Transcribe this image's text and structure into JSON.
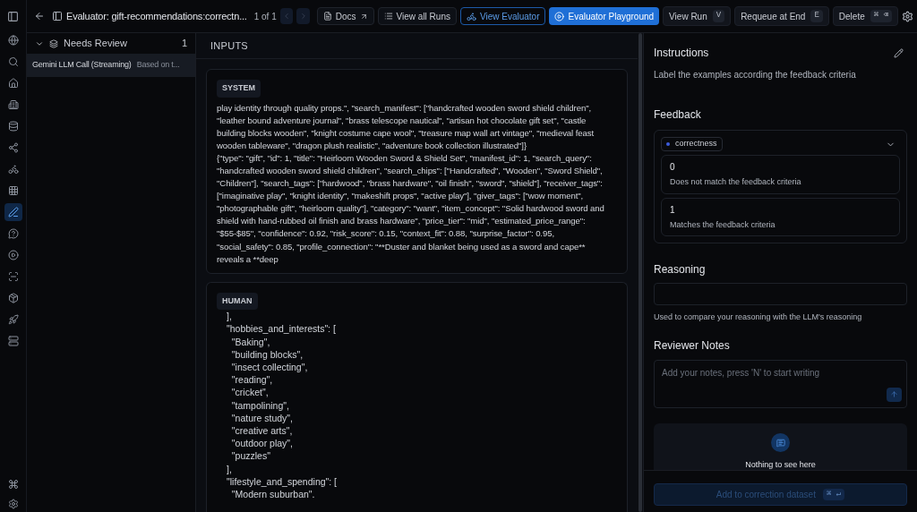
{
  "nav_rail": [
    {
      "selected": false
    },
    {
      "selected": false
    },
    {
      "selected": false
    },
    {
      "selected": false
    },
    {
      "selected": false
    },
    {
      "selected": false
    },
    {
      "selected": false
    },
    {
      "selected": false
    },
    {
      "selected": true
    },
    {
      "selected": false
    },
    {
      "selected": false
    },
    {
      "selected": false
    },
    {
      "selected": false
    },
    {
      "selected": false
    },
    {
      "selected": false
    }
  ],
  "header": {
    "title": "Evaluator: gift-recommendations:correctn...",
    "pager": "1 of 1",
    "buttons": [
      {
        "kind": "outline",
        "label": "Docs"
      },
      {
        "kind": "outline",
        "label": "View all Runs"
      },
      {
        "kind": "accent",
        "label": "View Evaluator"
      },
      {
        "kind": "primary",
        "label": "Evaluator Playground"
      },
      {
        "kind": "shortcut",
        "label": "View Run",
        "key": "V"
      },
      {
        "kind": "shortcut",
        "label": "Requeue at End",
        "key": "E"
      },
      {
        "kind": "shortcut",
        "label": "Delete",
        "key": "⌘ ⌫"
      }
    ]
  },
  "queue": {
    "group": {
      "label": "Needs Review",
      "count": "1",
      "expanded": true
    },
    "items": [
      {
        "title": "Gemini LLM Call (Streaming)",
        "preview": "Based on t...",
        "selected": true
      }
    ]
  },
  "inputs": {
    "title": "INPUTS",
    "system": {
      "label": "SYSTEM",
      "paragraphs": [
        "play identity through quality props.\", \"search_manifest\": [\"handcrafted wooden sword shield children\", \"leather bound adventure journal\", \"brass telescope nautical\", \"artisan hot chocolate gift set\", \"castle building blocks wooden\", \"knight costume cape wool\", \"treasure map wall art vintage\", \"medieval feast wooden tableware\", \"dragon plush realistic\", \"adventure book collection illustrated\"]}",
        "{\"type\": \"gift\", \"id\": 1, \"title\": \"Heirloom Wooden Sword & Shield Set\", \"manifest_id\": 1, \"search_query\": \"handcrafted wooden sword shield children\", \"search_chips\": [\"Handcrafted\", \"Wooden\", \"Sword Shield\", \"Children\"], \"search_tags\": [\"hardwood\", \"brass hardware\", \"oil finish\", \"sword\", \"shield\"], \"receiver_tags\": [\"imaginative play\", \"knight identity\", \"makeshift props\", \"active play\"], \"giver_tags\": [\"wow moment\", \"photographable gift\", \"heirloom quality\"], \"category\": \"want\", \"item_concept\": \"Solid hardwood sword and shield with hand-rubbed oil finish and brass hardware\", \"price_tier\": \"mid\", \"estimated_price_range\": \"$55-$85\", \"confidence\": 0.92, \"risk_score\": 0.15, \"context_fit\": 0.88, \"surprise_factor\": 0.95, \"social_safety\": 0.85, \"profile_connection\": \"**Duster and blanket being used as a sword and cape** reveals a **deep"
      ]
    },
    "human": {
      "label": "HUMAN",
      "lines": [
        "],",
        "\"hobbies_and_interests\": [",
        "  \"Baking\",",
        "  \"building blocks\",",
        "  \"insect collecting\",",
        "  \"reading\",",
        "  \"cricket\",",
        "  \"tampolining\",",
        "  \"nature study\",",
        "  \"creative arts\",",
        "  \"outdoor play\",",
        "  \"puzzles\"",
        "],",
        "\"lifestyle_and_spending\": [",
        "  \"Modern suburban\"."
      ]
    }
  },
  "instructions": {
    "title": "Instructions",
    "text": "Label the examples according the feedback criteria"
  },
  "feedback": {
    "title": "Feedback",
    "key": {
      "label": "correctness",
      "color": "#3b5bdb"
    },
    "options": [
      {
        "value": "0",
        "description": "Does not match the feedback criteria",
        "selected": false
      },
      {
        "value": "1",
        "description": "Matches the feedback criteria",
        "selected": false
      }
    ]
  },
  "reasoning": {
    "title": "Reasoning",
    "hint": "Used to compare your reasoning with the LLM's reasoning"
  },
  "notes": {
    "title": "Reviewer Notes",
    "placeholder": "Add your notes, press 'N' to start writing"
  },
  "empty_state": {
    "text": "Nothing to see here"
  },
  "footer": {
    "button": "Add to correction dataset",
    "key": "⌘ ↵",
    "disabled": true
  }
}
